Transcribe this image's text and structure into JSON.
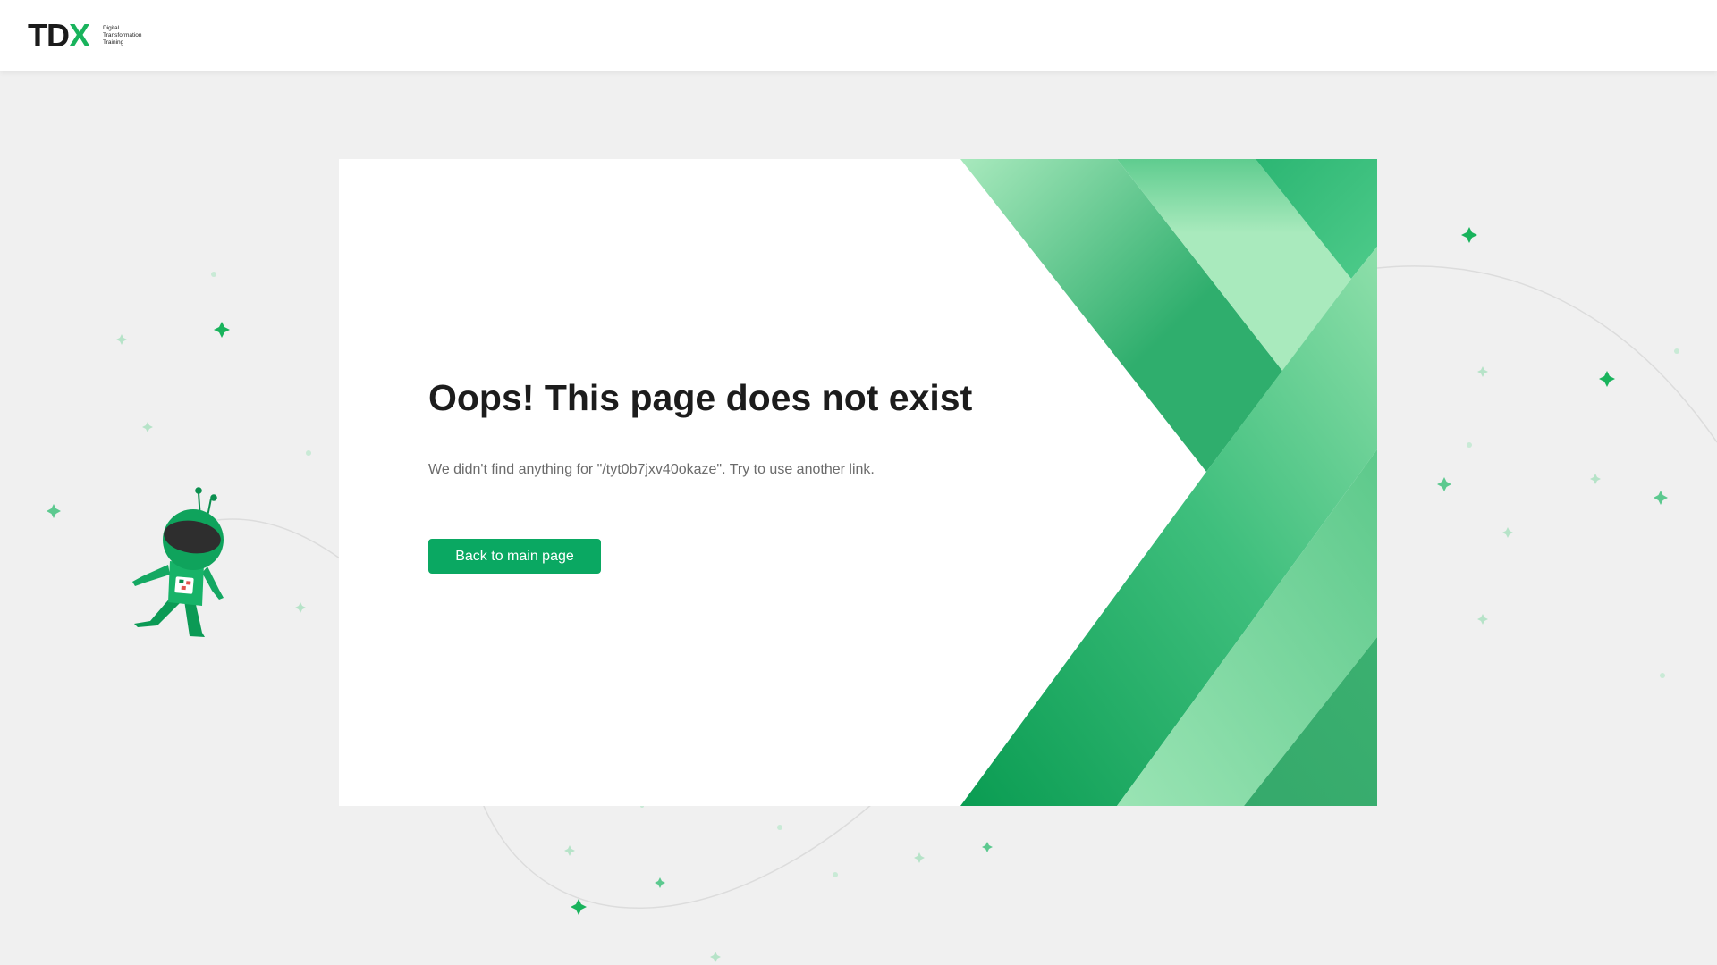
{
  "header": {
    "logo": {
      "letters": [
        "T",
        "D",
        "X"
      ],
      "tagline": [
        "Digital",
        "Transformation",
        "Training"
      ]
    }
  },
  "error": {
    "title": "Oops! This page does not exist",
    "message": "We didn't find anything for \"/tyt0b7jxv40okaze\". Try to use another link.",
    "button_label": "Back to main page"
  },
  "colors": {
    "accent": "#0aa862",
    "brand_green": "#19b35c",
    "background": "#f0f0f0",
    "card": "#ffffff",
    "title": "#1c1c1c",
    "message": "#6b6b6b"
  },
  "icons": {
    "illustration": "astronaut-illustration",
    "decorations": "sparkle-icon"
  }
}
